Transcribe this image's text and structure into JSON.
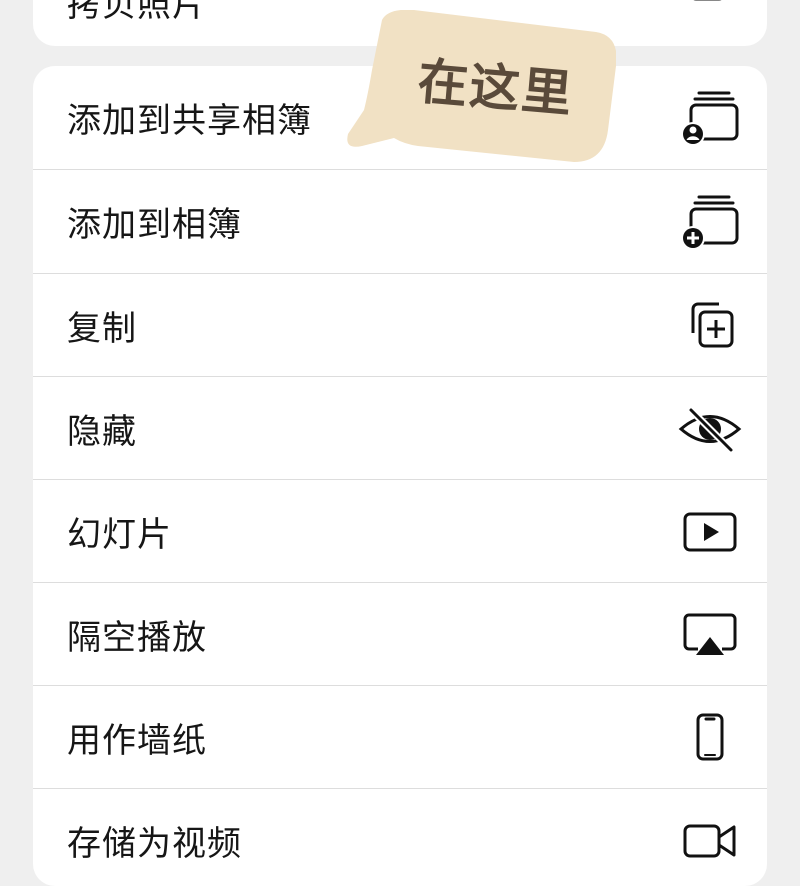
{
  "top_card": {
    "label": "拷贝照片",
    "icon": "copy-photo-icon"
  },
  "menu": {
    "items": [
      {
        "label": "添加到共享相簿",
        "icon": "shared-album-icon"
      },
      {
        "label": "添加到相簿",
        "icon": "add-to-album-icon"
      },
      {
        "label": "复制",
        "icon": "duplicate-icon"
      },
      {
        "label": "隐藏",
        "icon": "eye-slash-icon"
      },
      {
        "label": "幻灯片",
        "icon": "play-rectangle-icon"
      },
      {
        "label": "隔空播放",
        "icon": "airplay-icon"
      },
      {
        "label": "用作墙纸",
        "icon": "iphone-icon"
      },
      {
        "label": "存储为视频",
        "icon": "video-camera-icon"
      }
    ]
  },
  "callout": {
    "text": "在这里",
    "color": "#f1e1c4",
    "text_color": "#5a4a3a"
  }
}
